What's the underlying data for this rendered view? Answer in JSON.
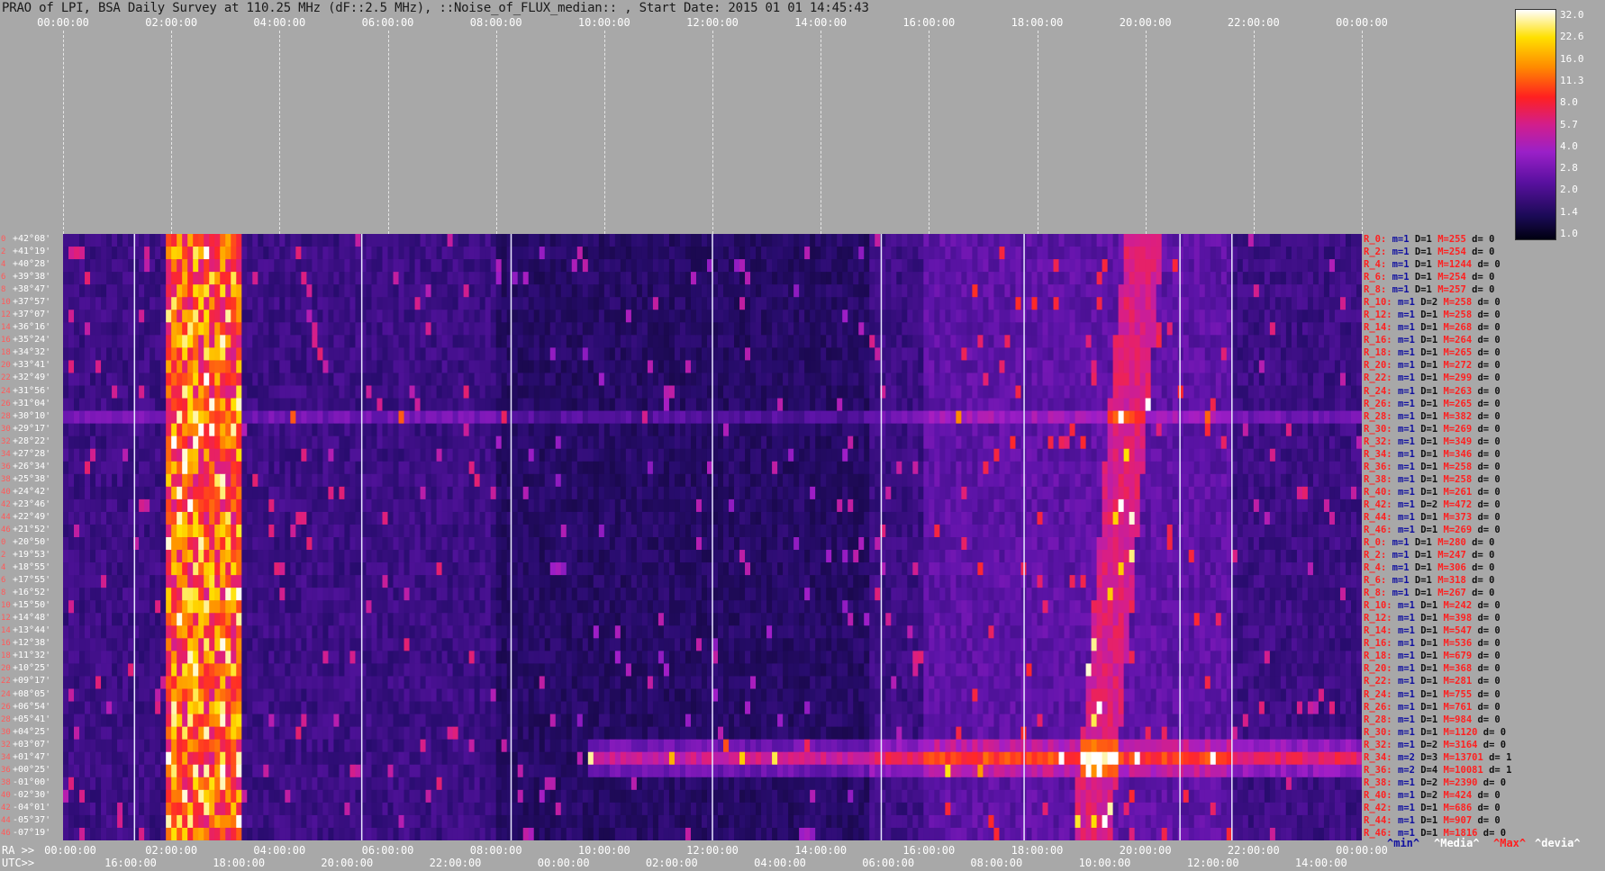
{
  "title": "PRAO of LPI, BSA Daily Survey at 110.25 MHz (dF::2.5 MHz), ::Noise_of_FLUX_median:: , Start Date: 2015 01 01 14:45:43",
  "chart_data": {
    "type": "heatmap",
    "x_top_ticks": [
      "00:00:00",
      "02:00:00",
      "04:00:00",
      "06:00:00",
      "08:00:00",
      "10:00:00",
      "12:00:00",
      "14:00:00",
      "16:00:00",
      "18:00:00",
      "20:00:00",
      "22:00:00",
      "00:00:00"
    ],
    "x_ra_label": "RA >>",
    "x_ra_ticks": [
      "00:00:00",
      "02:00:00",
      "04:00:00",
      "06:00:00",
      "08:00:00",
      "10:00:00",
      "12:00:00",
      "14:00:00",
      "16:00:00",
      "18:00:00",
      "20:00:00",
      "22:00:00",
      "00:00:00"
    ],
    "x_utc_label": "UTC>>",
    "x_utc_ticks": [
      "16:00:00",
      "18:00:00",
      "20:00:00",
      "22:00:00",
      "00:00:00",
      "02:00:00",
      "04:00:00",
      "06:00:00",
      "08:00:00",
      "10:00:00",
      "12:00:00",
      "14:00:00"
    ],
    "y_labels": [
      "+42°08'",
      "+41°19'",
      "+40°28'",
      "+39°38'",
      "+38°47'",
      "+37°57'",
      "+37°07'",
      "+36°16'",
      "+35°24'",
      "+34°32'",
      "+33°41'",
      "+32°49'",
      "+31°56'",
      "+31°04'",
      "+30°10'",
      "+29°17'",
      "+28°22'",
      "+27°28'",
      "+26°34'",
      "+25°38'",
      "+24°42'",
      "+23°46'",
      "+22°49'",
      "+21°52'",
      "+20°50'",
      "+19°53'",
      "+18°55'",
      "+17°55'",
      "+16°52'",
      "+15°50'",
      "+14°48'",
      "+13°44'",
      "+12°38'",
      "+11°32'",
      "+10°25'",
      "+09°17'",
      "+08°05'",
      "+06°54'",
      "+05°41'",
      "+04°25'",
      "+03°07'",
      "+01°47'",
      "+00°25'",
      "-01°00'",
      "-02°30'",
      "-04°01'",
      "-05°37'",
      "-07°19'"
    ],
    "row_indices": [
      "0",
      "2",
      "4",
      "6",
      "8",
      "10",
      "12",
      "14",
      "16",
      "18",
      "20",
      "22",
      "24",
      "26",
      "28",
      "30",
      "32",
      "34",
      "36",
      "38",
      "40",
      "42",
      "44",
      "46",
      "0",
      "2",
      "4",
      "6",
      "8",
      "10",
      "12",
      "14",
      "16",
      "18",
      "20",
      "22",
      "24",
      "26",
      "28",
      "30",
      "32",
      "34",
      "36",
      "38",
      "40",
      "42",
      "44",
      "46"
    ],
    "row_stats": [
      {
        "r": "R_0:",
        "m": "m=1",
        "D": "D=1",
        "M": "M=255",
        "d": "d= 0"
      },
      {
        "r": "R_2:",
        "m": "m=1",
        "D": "D=1",
        "M": "M=254",
        "d": "d= 0"
      },
      {
        "r": "R_4:",
        "m": "m=1",
        "D": "D=1",
        "M": "M=1244",
        "d": "d= 0"
      },
      {
        "r": "R_6:",
        "m": "m=1",
        "D": "D=1",
        "M": "M=254",
        "d": "d= 0"
      },
      {
        "r": "R_8:",
        "m": "m=1",
        "D": "D=1",
        "M": "M=257",
        "d": "d= 0"
      },
      {
        "r": "R_10:",
        "m": "m=1",
        "D": "D=2",
        "M": "M=258",
        "d": "d= 0"
      },
      {
        "r": "R_12:",
        "m": "m=1",
        "D": "D=1",
        "M": "M=258",
        "d": "d= 0"
      },
      {
        "r": "R_14:",
        "m": "m=1",
        "D": "D=1",
        "M": "M=268",
        "d": "d= 0"
      },
      {
        "r": "R_16:",
        "m": "m=1",
        "D": "D=1",
        "M": "M=264",
        "d": "d= 0"
      },
      {
        "r": "R_18:",
        "m": "m=1",
        "D": "D=1",
        "M": "M=265",
        "d": "d= 0"
      },
      {
        "r": "R_20:",
        "m": "m=1",
        "D": "D=1",
        "M": "M=272",
        "d": "d= 0"
      },
      {
        "r": "R_22:",
        "m": "m=1",
        "D": "D=1",
        "M": "M=299",
        "d": "d= 0"
      },
      {
        "r": "R_24:",
        "m": "m=1",
        "D": "D=1",
        "M": "M=263",
        "d": "d= 0"
      },
      {
        "r": "R_26:",
        "m": "m=1",
        "D": "D=1",
        "M": "M=265",
        "d": "d= 0"
      },
      {
        "r": "R_28:",
        "m": "m=1",
        "D": "D=1",
        "M": "M=382",
        "d": "d= 0"
      },
      {
        "r": "R_30:",
        "m": "m=1",
        "D": "D=1",
        "M": "M=269",
        "d": "d= 0"
      },
      {
        "r": "R_32:",
        "m": "m=1",
        "D": "D=1",
        "M": "M=349",
        "d": "d= 0"
      },
      {
        "r": "R_34:",
        "m": "m=1",
        "D": "D=1",
        "M": "M=346",
        "d": "d= 0"
      },
      {
        "r": "R_36:",
        "m": "m=1",
        "D": "D=1",
        "M": "M=258",
        "d": "d= 0"
      },
      {
        "r": "R_38:",
        "m": "m=1",
        "D": "D=1",
        "M": "M=258",
        "d": "d= 0"
      },
      {
        "r": "R_40:",
        "m": "m=1",
        "D": "D=1",
        "M": "M=261",
        "d": "d= 0"
      },
      {
        "r": "R_42:",
        "m": "m=1",
        "D": "D=2",
        "M": "M=472",
        "d": "d= 0"
      },
      {
        "r": "R_44:",
        "m": "m=1",
        "D": "D=1",
        "M": "M=373",
        "d": "d= 0"
      },
      {
        "r": "R_46:",
        "m": "m=1",
        "D": "D=1",
        "M": "M=269",
        "d": "d= 0"
      },
      {
        "r": "R_0:",
        "m": "m=1",
        "D": "D=1",
        "M": "M=280",
        "d": "d= 0"
      },
      {
        "r": "R_2:",
        "m": "m=1",
        "D": "D=1",
        "M": "M=247",
        "d": "d= 0"
      },
      {
        "r": "R_4:",
        "m": "m=1",
        "D": "D=1",
        "M": "M=306",
        "d": "d= 0"
      },
      {
        "r": "R_6:",
        "m": "m=1",
        "D": "D=1",
        "M": "M=318",
        "d": "d= 0"
      },
      {
        "r": "R_8:",
        "m": "m=1",
        "D": "D=1",
        "M": "M=267",
        "d": "d= 0"
      },
      {
        "r": "R_10:",
        "m": "m=1",
        "D": "D=1",
        "M": "M=242",
        "d": "d= 0"
      },
      {
        "r": "R_12:",
        "m": "m=1",
        "D": "D=1",
        "M": "M=398",
        "d": "d= 0"
      },
      {
        "r": "R_14:",
        "m": "m=1",
        "D": "D=1",
        "M": "M=547",
        "d": "d= 0"
      },
      {
        "r": "R_16:",
        "m": "m=1",
        "D": "D=1",
        "M": "M=536",
        "d": "d= 0"
      },
      {
        "r": "R_18:",
        "m": "m=1",
        "D": "D=1",
        "M": "M=679",
        "d": "d= 0"
      },
      {
        "r": "R_20:",
        "m": "m=1",
        "D": "D=1",
        "M": "M=368",
        "d": "d= 0"
      },
      {
        "r": "R_22:",
        "m": "m=1",
        "D": "D=1",
        "M": "M=281",
        "d": "d= 0"
      },
      {
        "r": "R_24:",
        "m": "m=1",
        "D": "D=1",
        "M": "M=755",
        "d": "d= 0"
      },
      {
        "r": "R_26:",
        "m": "m=1",
        "D": "D=1",
        "M": "M=761",
        "d": "d= 0"
      },
      {
        "r": "R_28:",
        "m": "m=1",
        "D": "D=1",
        "M": "M=984",
        "d": "d= 0"
      },
      {
        "r": "R_30:",
        "m": "m=1",
        "D": "D=1",
        "M": "M=1120",
        "d": "d= 0"
      },
      {
        "r": "R_32:",
        "m": "m=1",
        "D": "D=2",
        "M": "M=3164",
        "d": "d= 0"
      },
      {
        "r": "R_34:",
        "m": "m=2",
        "D": "D=3",
        "M": "M=13701",
        "d": "d= 1"
      },
      {
        "r": "R_36:",
        "m": "m=2",
        "D": "D=4",
        "M": "M=10081",
        "d": "d= 1"
      },
      {
        "r": "R_38:",
        "m": "m=1",
        "D": "D=2",
        "M": "M=2390",
        "d": "d= 0"
      },
      {
        "r": "R_40:",
        "m": "m=1",
        "D": "D=2",
        "M": "M=424",
        "d": "d= 0"
      },
      {
        "r": "R_42:",
        "m": "m=1",
        "D": "D=1",
        "M": "M=686",
        "d": "d= 0"
      },
      {
        "r": "R_44:",
        "m": "m=1",
        "D": "D=1",
        "M": "M=907",
        "d": "d= 0"
      },
      {
        "r": "R_46:",
        "m": "m=1",
        "D": "D=1",
        "M": "M=1816",
        "d": "d= 0"
      }
    ],
    "stats_legend": [
      "^min^",
      "^Media^",
      "^Max^",
      "^devia^"
    ],
    "colorbar_ticks": [
      "32.0",
      "22.6",
      "16.0",
      "11.3",
      "8.0",
      "5.7",
      "4.0",
      "2.8",
      "2.0",
      "1.4",
      "1.0"
    ],
    "colorbar_range": [
      1.0,
      32.0
    ],
    "colorbar_scale": "log",
    "colors": {
      "background": "#a8a8a8",
      "plot_base": "#1b0d4a",
      "text_labels": "#ffffff",
      "row_stat_R": "#ff2020",
      "row_stat_m": "#1010a0",
      "legend_min": "#1010a0",
      "legend_media": "#ffffff",
      "legend_max": "#ff2020",
      "legend_devia": "#ffffff"
    }
  }
}
